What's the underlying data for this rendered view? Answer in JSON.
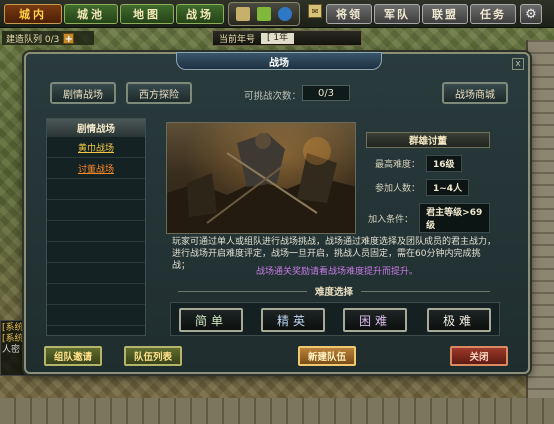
{
  "top_nav": {
    "items": [
      "城内",
      "城池",
      "地图",
      "战场"
    ],
    "active_index": 0,
    "right_items": [
      "将领",
      "军队",
      "联盟",
      "任务"
    ]
  },
  "build_queue": {
    "label": "建造队列 0/3",
    "add_label": "+"
  },
  "year_bar": {
    "label": "当前年号",
    "value": "[ 1年"
  },
  "chat_stub": {
    "lines": [
      "[系统",
      "[系统",
      "人密"
    ]
  },
  "dialog": {
    "title": "战场",
    "close_label": "x",
    "tabs": [
      "剧情战场",
      "西方探险",
      "战场商城"
    ],
    "challenge_label": "可挑战次数：",
    "challenge_value": "0/3",
    "left_list": {
      "header": "剧情战场",
      "items": [
        "黄巾战场",
        "讨董战场"
      ],
      "selected_index": 1
    },
    "detail": {
      "name": "群雄讨董",
      "rows": [
        {
          "label": "最高难度：",
          "value": "16级"
        },
        {
          "label": "参加人数：",
          "value": "1~4人"
        },
        {
          "label": "加入条件：",
          "value": "君主等级>69级"
        }
      ]
    },
    "description": "玩家可通过单人或组队进行战场挑战，战场通过难度选择及团队成员的君主战力，进行战场开启难度评定，战场一旦开启，挑战人员固定，需在60分钟内完成挑战；",
    "tip": "战场通关奖励请看战场难度提升而提升。",
    "difficulty_title": "难度选择",
    "difficulties": [
      "简单",
      "精英",
      "困难",
      "极难"
    ],
    "buttons": {
      "team_invite": "组队邀请",
      "team_list": "队伍列表",
      "new_team": "新建队伍",
      "close": "关闭"
    }
  }
}
